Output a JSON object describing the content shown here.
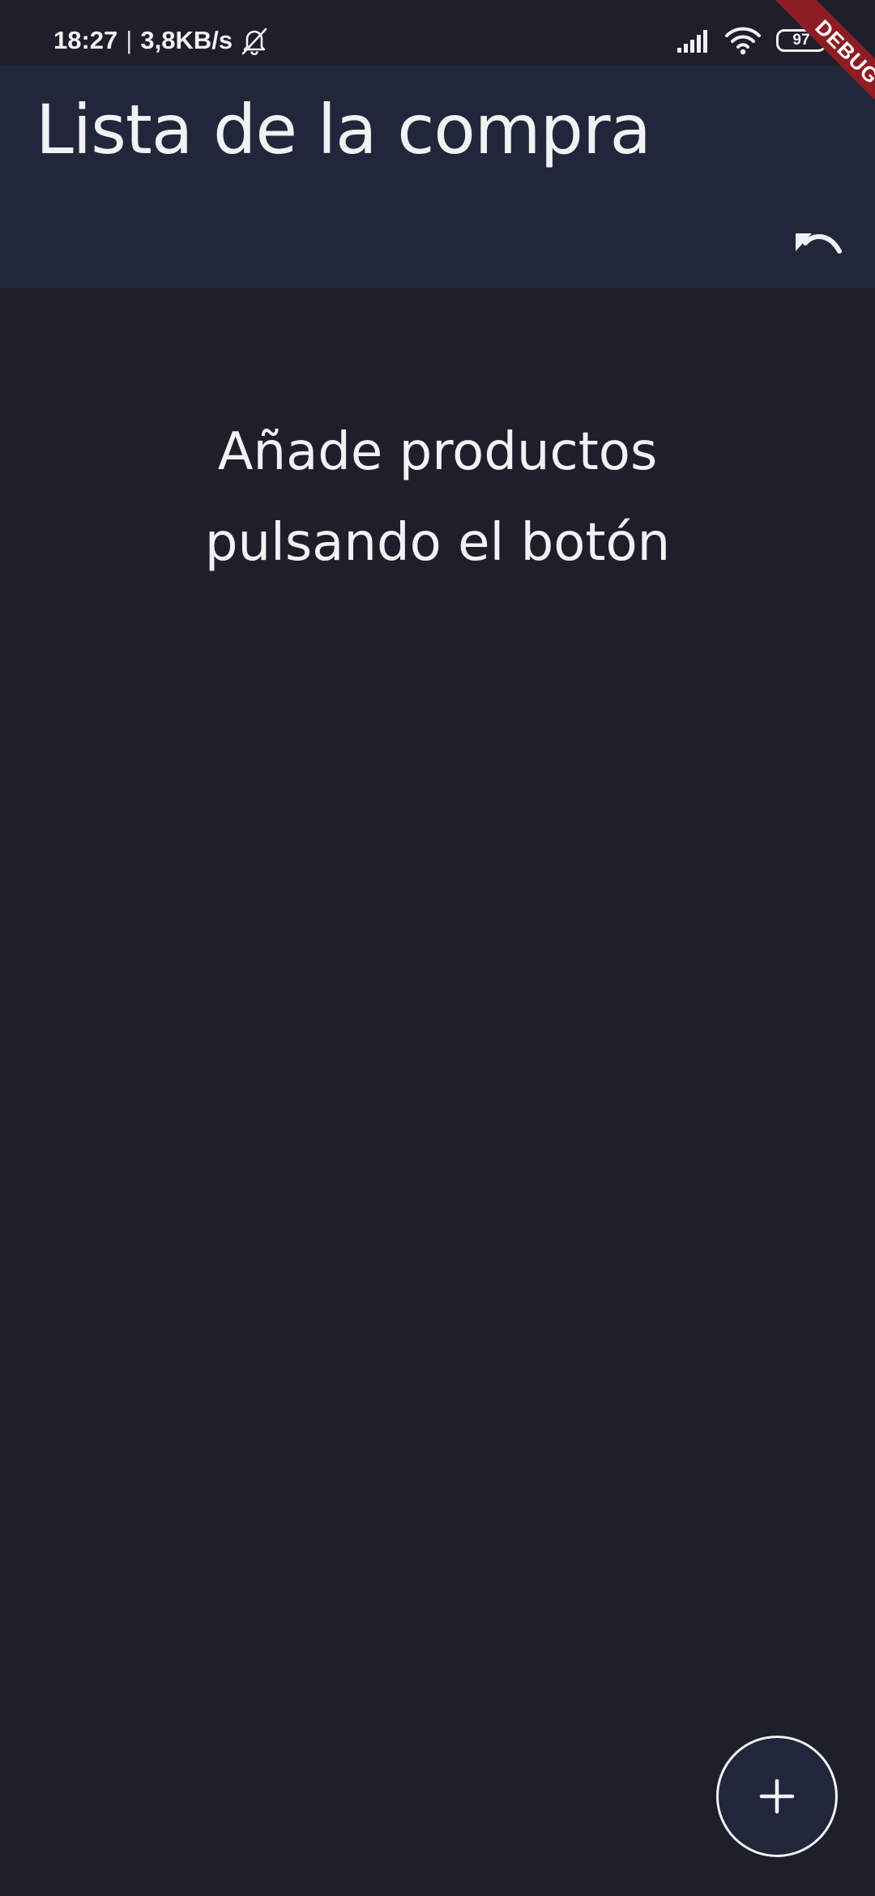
{
  "status_bar": {
    "time": "18:27",
    "separator": "|",
    "network_speed": "3,8KB/s",
    "silent_icon": "bell-off-icon",
    "signal_icon": "cellular-signal-icon",
    "wifi_icon": "wifi-icon",
    "battery_level": "97"
  },
  "app_bar": {
    "title": "Lista de la compra",
    "undo_icon": "undo-icon",
    "background_color": "#22263a"
  },
  "main": {
    "empty_line_1": "Añade productos",
    "empty_line_2": "pulsando el botón",
    "background_color": "#1d1f2b"
  },
  "fab": {
    "icon": "plus-icon"
  },
  "debug_banner": {
    "label": "DEBUG",
    "color": "#8c1d24"
  }
}
